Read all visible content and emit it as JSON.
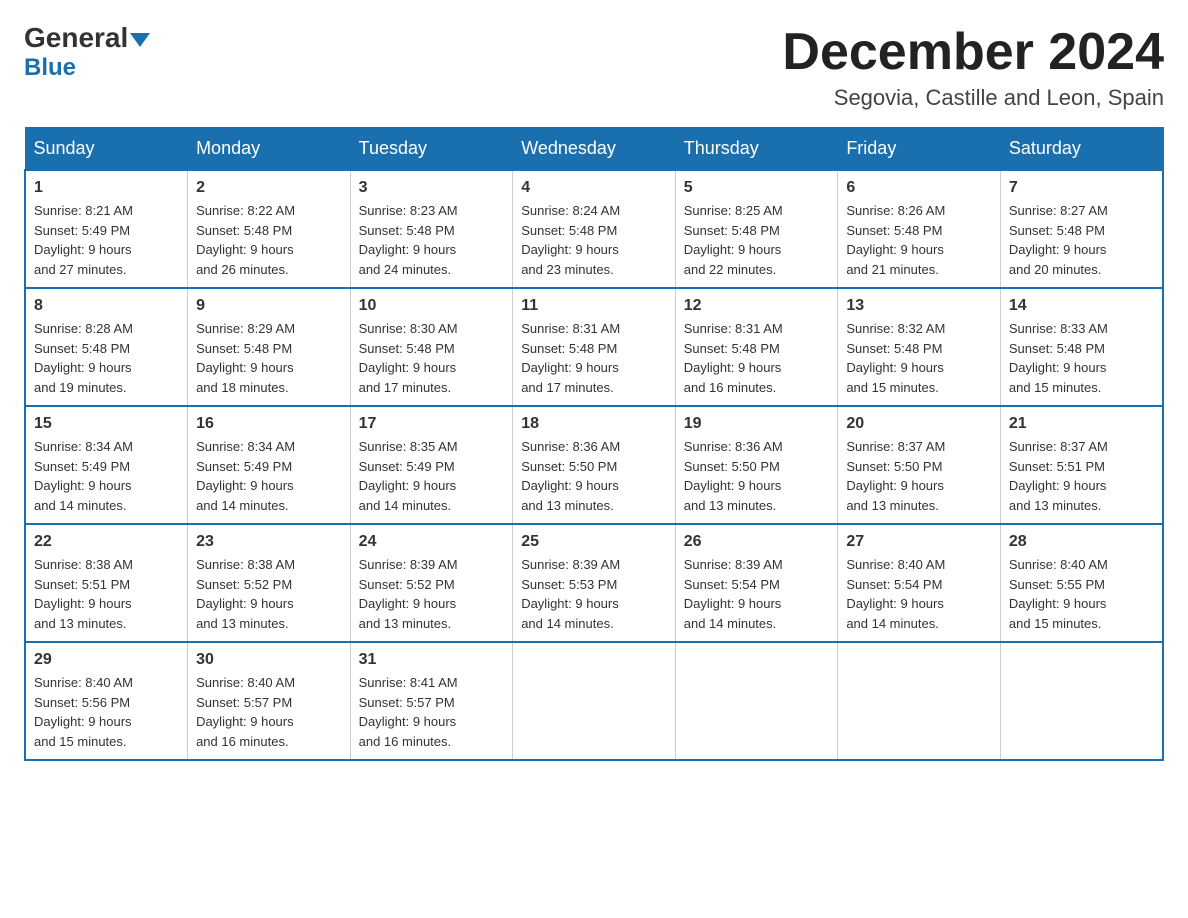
{
  "header": {
    "logo_top": "General",
    "logo_bottom": "Blue",
    "title": "December 2024",
    "subtitle": "Segovia, Castille and Leon, Spain"
  },
  "days_of_week": [
    "Sunday",
    "Monday",
    "Tuesday",
    "Wednesday",
    "Thursday",
    "Friday",
    "Saturday"
  ],
  "weeks": [
    [
      {
        "num": "1",
        "sunrise": "8:21 AM",
        "sunset": "5:49 PM",
        "daylight": "9 hours and 27 minutes."
      },
      {
        "num": "2",
        "sunrise": "8:22 AM",
        "sunset": "5:48 PM",
        "daylight": "9 hours and 26 minutes."
      },
      {
        "num": "3",
        "sunrise": "8:23 AM",
        "sunset": "5:48 PM",
        "daylight": "9 hours and 24 minutes."
      },
      {
        "num": "4",
        "sunrise": "8:24 AM",
        "sunset": "5:48 PM",
        "daylight": "9 hours and 23 minutes."
      },
      {
        "num": "5",
        "sunrise": "8:25 AM",
        "sunset": "5:48 PM",
        "daylight": "9 hours and 22 minutes."
      },
      {
        "num": "6",
        "sunrise": "8:26 AM",
        "sunset": "5:48 PM",
        "daylight": "9 hours and 21 minutes."
      },
      {
        "num": "7",
        "sunrise": "8:27 AM",
        "sunset": "5:48 PM",
        "daylight": "9 hours and 20 minutes."
      }
    ],
    [
      {
        "num": "8",
        "sunrise": "8:28 AM",
        "sunset": "5:48 PM",
        "daylight": "9 hours and 19 minutes."
      },
      {
        "num": "9",
        "sunrise": "8:29 AM",
        "sunset": "5:48 PM",
        "daylight": "9 hours and 18 minutes."
      },
      {
        "num": "10",
        "sunrise": "8:30 AM",
        "sunset": "5:48 PM",
        "daylight": "9 hours and 17 minutes."
      },
      {
        "num": "11",
        "sunrise": "8:31 AM",
        "sunset": "5:48 PM",
        "daylight": "9 hours and 17 minutes."
      },
      {
        "num": "12",
        "sunrise": "8:31 AM",
        "sunset": "5:48 PM",
        "daylight": "9 hours and 16 minutes."
      },
      {
        "num": "13",
        "sunrise": "8:32 AM",
        "sunset": "5:48 PM",
        "daylight": "9 hours and 15 minutes."
      },
      {
        "num": "14",
        "sunrise": "8:33 AM",
        "sunset": "5:48 PM",
        "daylight": "9 hours and 15 minutes."
      }
    ],
    [
      {
        "num": "15",
        "sunrise": "8:34 AM",
        "sunset": "5:49 PM",
        "daylight": "9 hours and 14 minutes."
      },
      {
        "num": "16",
        "sunrise": "8:34 AM",
        "sunset": "5:49 PM",
        "daylight": "9 hours and 14 minutes."
      },
      {
        "num": "17",
        "sunrise": "8:35 AM",
        "sunset": "5:49 PM",
        "daylight": "9 hours and 14 minutes."
      },
      {
        "num": "18",
        "sunrise": "8:36 AM",
        "sunset": "5:50 PM",
        "daylight": "9 hours and 13 minutes."
      },
      {
        "num": "19",
        "sunrise": "8:36 AM",
        "sunset": "5:50 PM",
        "daylight": "9 hours and 13 minutes."
      },
      {
        "num": "20",
        "sunrise": "8:37 AM",
        "sunset": "5:50 PM",
        "daylight": "9 hours and 13 minutes."
      },
      {
        "num": "21",
        "sunrise": "8:37 AM",
        "sunset": "5:51 PM",
        "daylight": "9 hours and 13 minutes."
      }
    ],
    [
      {
        "num": "22",
        "sunrise": "8:38 AM",
        "sunset": "5:51 PM",
        "daylight": "9 hours and 13 minutes."
      },
      {
        "num": "23",
        "sunrise": "8:38 AM",
        "sunset": "5:52 PM",
        "daylight": "9 hours and 13 minutes."
      },
      {
        "num": "24",
        "sunrise": "8:39 AM",
        "sunset": "5:52 PM",
        "daylight": "9 hours and 13 minutes."
      },
      {
        "num": "25",
        "sunrise": "8:39 AM",
        "sunset": "5:53 PM",
        "daylight": "9 hours and 14 minutes."
      },
      {
        "num": "26",
        "sunrise": "8:39 AM",
        "sunset": "5:54 PM",
        "daylight": "9 hours and 14 minutes."
      },
      {
        "num": "27",
        "sunrise": "8:40 AM",
        "sunset": "5:54 PM",
        "daylight": "9 hours and 14 minutes."
      },
      {
        "num": "28",
        "sunrise": "8:40 AM",
        "sunset": "5:55 PM",
        "daylight": "9 hours and 15 minutes."
      }
    ],
    [
      {
        "num": "29",
        "sunrise": "8:40 AM",
        "sunset": "5:56 PM",
        "daylight": "9 hours and 15 minutes."
      },
      {
        "num": "30",
        "sunrise": "8:40 AM",
        "sunset": "5:57 PM",
        "daylight": "9 hours and 16 minutes."
      },
      {
        "num": "31",
        "sunrise": "8:41 AM",
        "sunset": "5:57 PM",
        "daylight": "9 hours and 16 minutes."
      },
      null,
      null,
      null,
      null
    ]
  ],
  "labels": {
    "sunrise": "Sunrise:",
    "sunset": "Sunset:",
    "daylight": "Daylight:"
  }
}
